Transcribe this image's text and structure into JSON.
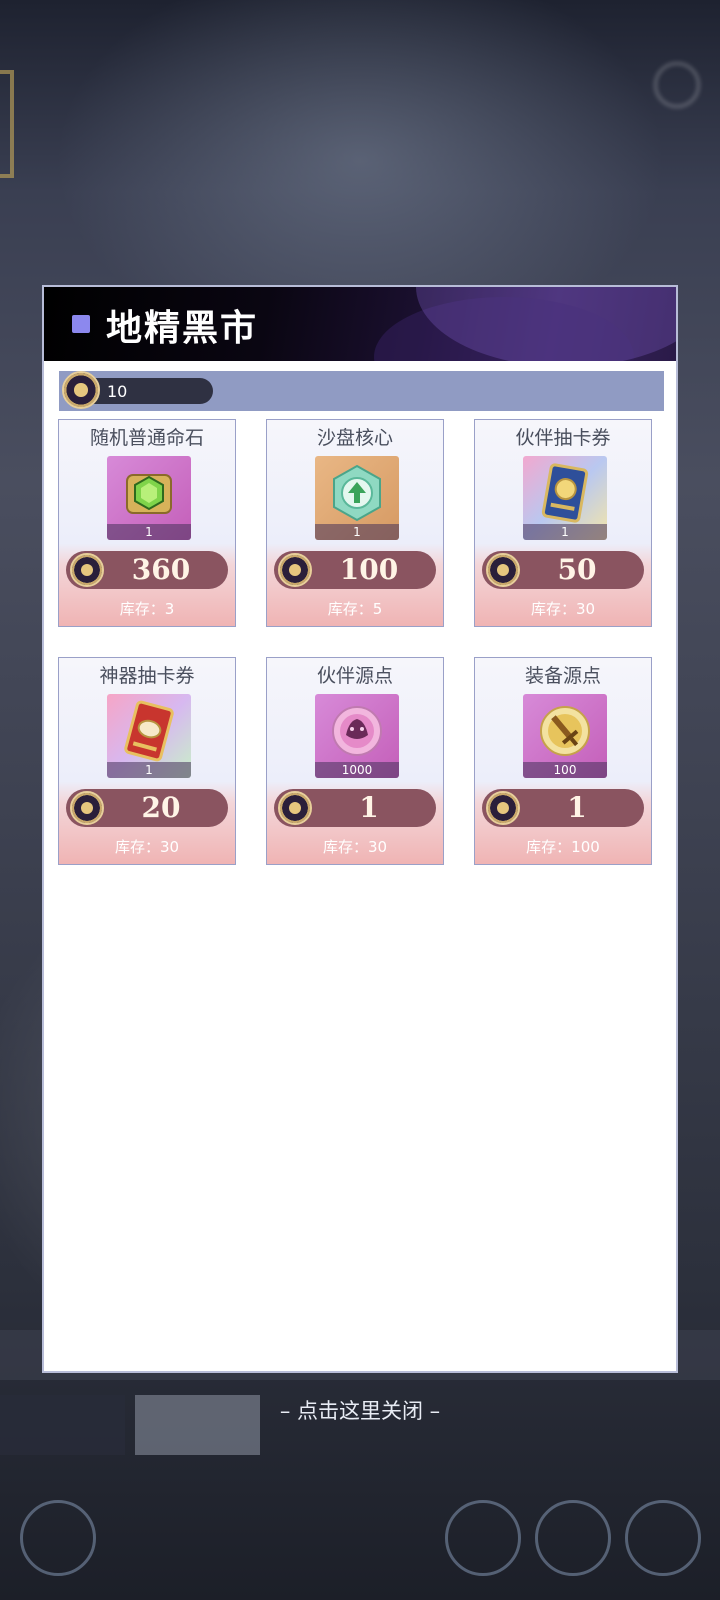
{
  "shop": {
    "title": "地精黑市",
    "currency_amount": "10",
    "currency_icon": "gold-chip-icon"
  },
  "items": [
    {
      "name": "随机普通命石",
      "icon": "green-gem-icon",
      "qty": "1",
      "price": "360",
      "stock": "库存：3"
    },
    {
      "name": "沙盘核心",
      "icon": "green-arrow-core-icon",
      "qty": "1",
      "price": "100",
      "stock": "库存：5"
    },
    {
      "name": "伙伴抽卡券",
      "icon": "blue-card-icon",
      "qty": "1",
      "price": "50",
      "stock": "库存：30"
    },
    {
      "name": "神器抽卡券",
      "icon": "red-card-icon",
      "qty": "1",
      "price": "20",
      "stock": "库存：30"
    },
    {
      "name": "伙伴源点",
      "icon": "pink-orb-icon",
      "qty": "1000",
      "price": "1",
      "stock": "库存：30"
    },
    {
      "name": "装备源点",
      "icon": "gold-sword-orb-icon",
      "qty": "100",
      "price": "1",
      "stock": "库存：100"
    }
  ],
  "footer": {
    "close_hint": "– 点击这里关闭 –"
  },
  "colors": {
    "header_bg": "#000000",
    "accent_square": "#8c88ee",
    "currency_bar": "#909bc3",
    "price_pill": "#8a5460",
    "item_bottom": "#f0b4b4"
  }
}
